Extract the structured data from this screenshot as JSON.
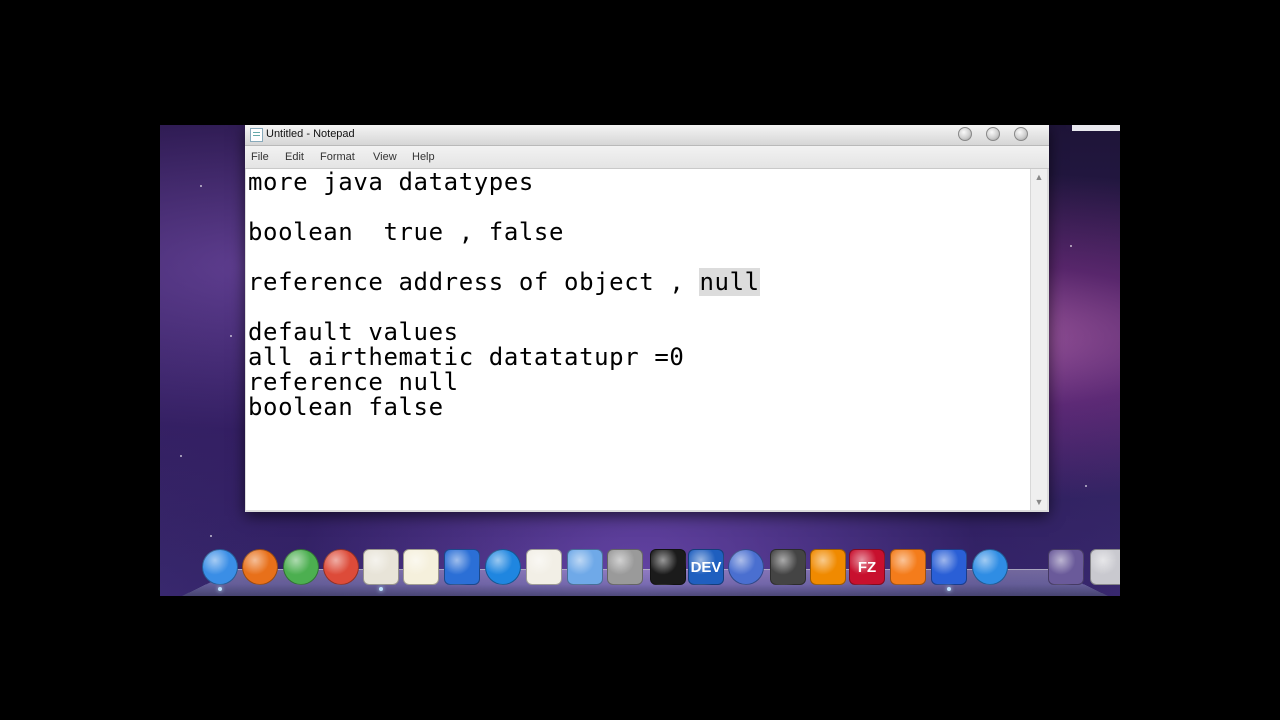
{
  "window": {
    "title": "Untitled - Notepad",
    "menu": [
      "File",
      "Edit",
      "Format",
      "View",
      "Help"
    ]
  },
  "editor": {
    "lines": [
      "more java datatypes",
      "",
      "boolean  true , false",
      "",
      "reference address of object , ",
      "",
      "default values",
      "all airthematic datatatupr =0",
      "reference null",
      "boolean false"
    ],
    "selected_text": "null"
  },
  "dock": {
    "items": [
      {
        "icon": "safari-icon",
        "color": "#3a8ee6"
      },
      {
        "icon": "firefox-icon",
        "color": "#e8701a"
      },
      {
        "icon": "app-green-icon",
        "color": "#4caf50"
      },
      {
        "icon": "chrome-icon",
        "color": "#dd4b39"
      },
      {
        "icon": "script-editor-icon",
        "color": "#e8e4d8"
      },
      {
        "icon": "textedit-icon",
        "color": "#f5f0dc"
      },
      {
        "icon": "film-icon",
        "color": "#2b6fd6"
      },
      {
        "icon": "quicktime-icon",
        "color": "#1f86e0"
      },
      {
        "icon": "home-icon",
        "color": "#f2efe6"
      },
      {
        "icon": "display-icon",
        "color": "#6fa9e8"
      },
      {
        "icon": "system-prefs-icon",
        "color": "#9a9a9a"
      },
      {
        "icon": "terminal-icon",
        "color": "#1b1b1b"
      },
      {
        "icon": "devcpp-icon",
        "color": "#1f5fbf",
        "label": "DEV"
      },
      {
        "icon": "links-icon",
        "color": "#4a6fd0"
      },
      {
        "icon": "unity-icon",
        "color": "#444444"
      },
      {
        "icon": "vlc-icon",
        "color": "#f08a00"
      },
      {
        "icon": "filezilla-icon",
        "color": "#c8102e",
        "label": "FZ"
      },
      {
        "icon": "xampp-icon",
        "color": "#f47c1b"
      },
      {
        "icon": "virtual-screen-icon",
        "color": "#2a5fd6"
      },
      {
        "icon": "download-icon",
        "color": "#2f8de4"
      },
      {
        "icon": "photo-icon",
        "color": "#6a5a9a"
      },
      {
        "icon": "trash-icon",
        "color": "#c9c9cf"
      }
    ]
  }
}
